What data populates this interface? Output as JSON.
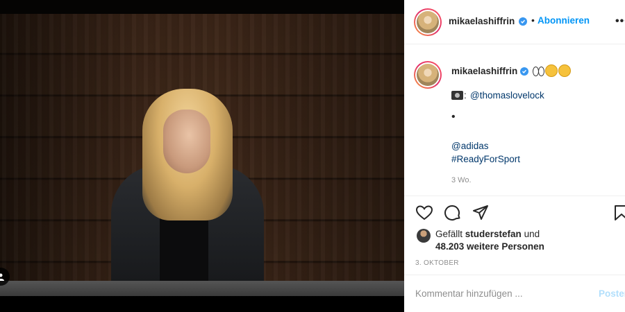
{
  "post": {
    "username": "mikaelashiffrin",
    "follow_label": "Abonnieren",
    "separator": "•",
    "more_label": "•••"
  },
  "caption": {
    "username": "mikaelashiffrin",
    "emojis": [
      "eyes-emoji",
      "thinking-emoji",
      "sweat-smile-emoji"
    ],
    "colon": ":",
    "photographer_mention": "@thomaslovelock",
    "bullet": "•",
    "brand_mention": "@adidas",
    "hashtag": "#ReadyForSport",
    "time_ago": "3 Wo."
  },
  "likes": {
    "prefix": "Gefällt ",
    "first_user": "studerstefan",
    "connector": " und",
    "others": "48.203 weitere Personen"
  },
  "date": "3. OKTOBER",
  "comment": {
    "placeholder": "Kommentar hinzufügen ...",
    "post_label": "Posten"
  },
  "colors": {
    "accent": "#0095f6",
    "verified": "#3897f0",
    "link": "#00376b",
    "muted": "#8e8e8e"
  }
}
